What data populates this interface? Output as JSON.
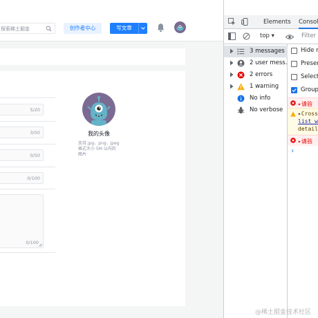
{
  "topbar": {
    "search_placeholder": "探索稀土掘金",
    "creator_label": "创作者中心",
    "write_label": "写文章"
  },
  "form": {
    "fields": [
      {
        "count": "5/20"
      },
      {
        "count": "3/50"
      },
      {
        "count": "0/50"
      },
      {
        "count": "0/100"
      }
    ],
    "textarea_count": "0/100"
  },
  "avatar": {
    "label": "我的头像",
    "hint": "支持 jpg、png、jpeg 格式大小 5M 以内的图片"
  },
  "devtools": {
    "tabs": {
      "elements": "Elements",
      "console": "Console"
    },
    "context": "top",
    "filter_placeholder": "Filter",
    "sidebar": [
      {
        "label": "3 messages",
        "icon": "list-icon"
      },
      {
        "label": "2 user mess…",
        "icon": "user-icon"
      },
      {
        "label": "2 errors",
        "icon": "error-icon"
      },
      {
        "label": "1 warning",
        "icon": "warning-icon"
      },
      {
        "label": "No info",
        "icon": "info-icon"
      },
      {
        "label": "No verbose",
        "icon": "bug-icon"
      }
    ],
    "options": [
      {
        "label": "Hide ne",
        "checked": false
      },
      {
        "label": "Preserv",
        "checked": false
      },
      {
        "label": "Selecte",
        "checked": false
      },
      {
        "label": "Group",
        "checked": true
      }
    ],
    "messages": {
      "err1": "▸请验",
      "warn_l1": "▸Cross",
      "warn_l2": "list w",
      "warn_l3": "detail",
      "err2": "▸请验"
    },
    "prompt": "›"
  },
  "watermark": "@稀土掘金技术社区",
  "colors": {
    "brand_blue": "#1e80ff",
    "devtools_blue": "#1a73e8",
    "error_red": "#e60000",
    "warning_yellow": "#f9ab00",
    "avatar_purple": "#7b6a91"
  }
}
